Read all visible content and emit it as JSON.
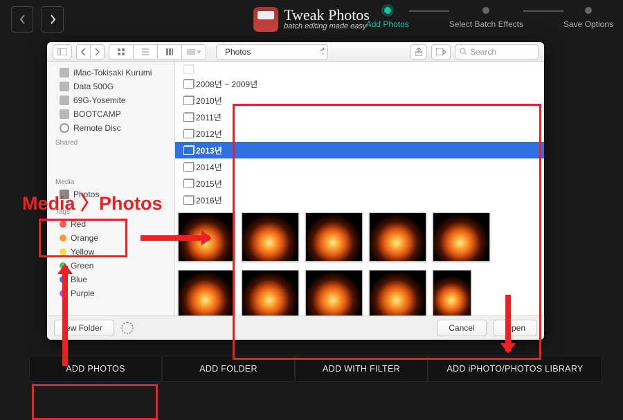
{
  "brand": {
    "title": "Tweak Photos",
    "subtitle": "batch editing made easy"
  },
  "steps": [
    {
      "label": "Add Photos",
      "active": true
    },
    {
      "label": "Select Batch Effects",
      "active": false
    },
    {
      "label": "Save Options",
      "active": false
    }
  ],
  "finder": {
    "path_label": "Photos",
    "search_placeholder": "Search",
    "sidebar": {
      "devices_clipped_label": "iMac-Tokisaki Kurumi",
      "devices": [
        "iMac-Tokisaki Kurumi",
        "Data 500G",
        "69G-Yosemite",
        "BOOTCAMP",
        "Remote Disc"
      ],
      "shared_header": "Shared",
      "media_header": "Media",
      "media_item": "Photos",
      "tags_header": "Tags",
      "tags": [
        {
          "label": "Red",
          "color": "#ff5b4f"
        },
        {
          "label": "Orange",
          "color": "#ff9a2e"
        },
        {
          "label": "Yellow",
          "color": "#ffd83d"
        },
        {
          "label": "Green",
          "color": "#3fcf57"
        },
        {
          "label": "Blue",
          "color": "#2f7bff"
        },
        {
          "label": "Purple",
          "color": "#b25bff"
        }
      ]
    },
    "years": [
      "2008년 ~ 2009년",
      "2010년",
      "2011년",
      "2012년",
      "2013년",
      "2014년",
      "2015년",
      "2016년"
    ],
    "selected_year_index": 4,
    "footer": {
      "new_folder": "ew Folder",
      "cancel": "Cancel",
      "open": "Open"
    }
  },
  "bottom_buttons": [
    "ADD PHOTOS",
    "ADD FOLDER",
    "ADD WITH FILTER",
    "ADD iPHOTO/PHOTOS LIBRARY"
  ],
  "annotation_text": "Media 〉Photos"
}
